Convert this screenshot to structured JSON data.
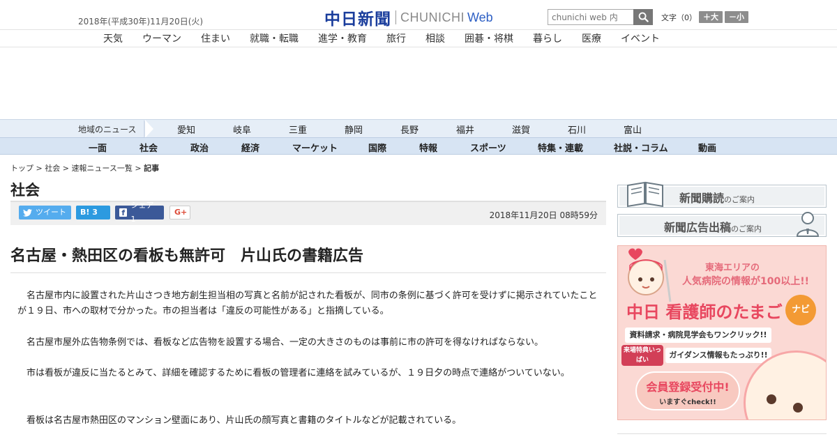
{
  "header": {
    "date": "2018年(平成30年)11月20日(火)",
    "logo_jp": "中日新聞",
    "logo_en": "CHUNICHI",
    "logo_web": "Web",
    "search_placeholder": "chunichi web 内",
    "font_label": "文字（0）",
    "font_larger": "＋大",
    "font_smaller": "－小"
  },
  "subnav": [
    "天気",
    "ウーマン",
    "住まい",
    "就職・転職",
    "進学・教育",
    "旅行",
    "相談",
    "囲碁・将棋",
    "暮らし",
    "医療",
    "イベント"
  ],
  "region": {
    "title": "地域のニュース",
    "items": [
      "愛知",
      "岐阜",
      "三重",
      "静岡",
      "長野",
      "福井",
      "滋賀",
      "石川",
      "富山"
    ]
  },
  "categories": [
    "一面",
    "社会",
    "政治",
    "経済",
    "マーケット",
    "国際",
    "特報",
    "スポーツ",
    "特集・連載",
    "社説・コラム",
    "動画"
  ],
  "breadcrumb": {
    "top": "トップ",
    "section": "社会",
    "list": "速報ニュース一覧",
    "current": "記事",
    "sep": " > "
  },
  "section_title": "社会",
  "share": {
    "tweet": "ツイート",
    "hatena": "B! 3",
    "facebook": "シェア 1",
    "gplus": "G+"
  },
  "pub_date": "2018年11月20日 08時59分",
  "article": {
    "headline": "名古屋・熱田区の看板も無許可　片山氏の書籍広告",
    "paragraphs": [
      "名古屋市内に設置された片山さつき地方創生担当相の写真と名前が記された看板が、同市の条例に基づく許可を受けずに掲示されていたことが１９日、市への取材で分かった。市の担当者は「違反の可能性がある」と指摘している。",
      "名古屋市屋外広告物条例では、看板など広告物を設置する場合、一定の大きさのものは事前に市の許可を得なければならない。",
      "市は看板が違反に当たるとみて、詳細を確認するために看板の管理者に連絡を試みているが、１９日夕の時点で連絡がついていない。",
      "看板は名古屋市熱田区のマンション壁面にあり、片山氏の顔写真と書籍のタイトルなどが記載されている。"
    ]
  },
  "sidebar": {
    "subscribe_big": "新聞購読",
    "subscribe_small": "のご案内",
    "ad_big": "新聞広告出稿",
    "ad_small": "のご案内",
    "banner": {
      "line1": "東海エリアの",
      "line2": "人気病院の情報が100以上!!",
      "title": "中日 看護師のたまご",
      "navi": "ナビ",
      "strip1": "資料請求・病院見学会もワンクリック!!",
      "badge": "来場特典いっぱい",
      "strip2": "ガイダンス情報もたっぷり!!",
      "cta1": "会員登録受付中!",
      "cta2": "いますぐcheck!!"
    }
  },
  "colors": {
    "brand_blue": "#1a3d9c",
    "region_bg": "#e6eef7",
    "category_bg": "#d7e4f3",
    "twitter": "#55acee",
    "hatena": "#2c9ae0",
    "facebook": "#3b5998"
  }
}
